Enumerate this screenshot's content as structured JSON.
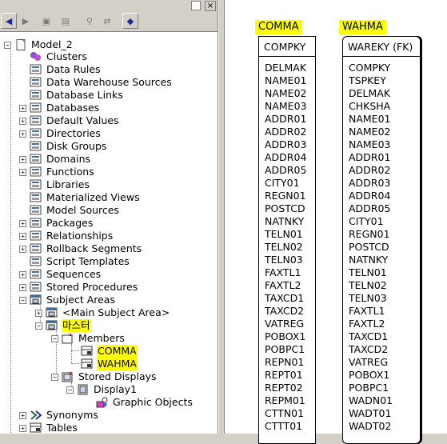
{
  "tree": {
    "root": "Model_2",
    "items": [
      {
        "label": "Clusters",
        "icon": "clusters-icon",
        "expander": ""
      },
      {
        "label": "Data Rules",
        "icon": "data-rules-icon",
        "expander": ""
      },
      {
        "label": "Data Warehouse Sources",
        "icon": "data-warehouse-icon",
        "expander": ""
      },
      {
        "label": "Database Links",
        "icon": "database-links-icon",
        "expander": ""
      },
      {
        "label": "Databases",
        "icon": "databases-icon",
        "expander": "+"
      },
      {
        "label": "Default Values",
        "icon": "default-values-icon",
        "expander": "+"
      },
      {
        "label": "Directories",
        "icon": "directories-icon",
        "expander": "+"
      },
      {
        "label": "Disk Groups",
        "icon": "disk-groups-icon",
        "expander": ""
      },
      {
        "label": "Domains",
        "icon": "domains-icon",
        "expander": "+"
      },
      {
        "label": "Functions",
        "icon": "functions-icon",
        "expander": "+"
      },
      {
        "label": "Libraries",
        "icon": "libraries-icon",
        "expander": ""
      },
      {
        "label": "Materialized Views",
        "icon": "materialized-views-icon",
        "expander": ""
      },
      {
        "label": "Model Sources",
        "icon": "model-sources-icon",
        "expander": ""
      },
      {
        "label": "Packages",
        "icon": "packages-icon",
        "expander": "+"
      },
      {
        "label": "Relationships",
        "icon": "relationships-icon",
        "expander": "+"
      },
      {
        "label": "Rollback Segments",
        "icon": "rollback-segments-icon",
        "expander": "+"
      },
      {
        "label": "Script Templates",
        "icon": "script-templates-icon",
        "expander": ""
      },
      {
        "label": "Sequences",
        "icon": "sequences-icon",
        "expander": "+"
      },
      {
        "label": "Stored Procedures",
        "icon": "stored-procedures-icon",
        "expander": "+"
      },
      {
        "label": "Subject Areas",
        "icon": "subject-areas-icon",
        "expander": "-"
      }
    ],
    "subject_areas": {
      "main": "<Main Subject Area>",
      "master": "마스터",
      "members": "Members",
      "member_items": [
        "COMMA",
        "WAHMA"
      ],
      "stored_displays": "Stored Displays",
      "display1": "Display1",
      "graphic_objects": "Graphic Objects"
    },
    "tail": [
      {
        "label": "Synonyms",
        "icon": "synonyms-icon",
        "expander": "+"
      },
      {
        "label": "Tables",
        "icon": "tables-icon",
        "expander": "+"
      }
    ]
  },
  "toolbar": {
    "close_label": "×"
  },
  "entities": [
    {
      "name": "COMMA",
      "pk": [
        "COMPKY"
      ],
      "columns": [
        "DELMAK",
        "NAME01",
        "NAME02",
        "NAME03",
        "ADDR01",
        "ADDR02",
        "ADDR03",
        "ADDR04",
        "ADDR05",
        "CITY01",
        "REGN01",
        "POSTCD",
        "NATNKY",
        "TELN01",
        "TELN02",
        "TELN03",
        "FAXTL1",
        "FAXTL2",
        "TAXCD1",
        "TAXCD2",
        "VATREG",
        "POBOX1",
        "POBPC1",
        "REPN01",
        "REPT01",
        "REPT02",
        "REPM01",
        "CTTN01",
        "CTTT01"
      ]
    },
    {
      "name": "WAHMA",
      "pk": [
        "WAREKY (FK)"
      ],
      "columns": [
        "COMPKY",
        "TSPKEY",
        "DELMAK",
        "CHKSHA",
        "NAME01",
        "NAME02",
        "NAME03",
        "ADDR01",
        "ADDR02",
        "ADDR03",
        "ADDR04",
        "ADDR05",
        "CITY01",
        "REGN01",
        "POSTCD",
        "NATNKY",
        "TELN01",
        "TELN02",
        "TELN03",
        "FAXTL1",
        "FAXTL2",
        "TAXCD1",
        "TAXCD2",
        "VATREG",
        "POBOX1",
        "POBPC1",
        "WADN01",
        "WADT01",
        "WADT02"
      ]
    }
  ],
  "colors": {
    "highlight": "#ffff00",
    "window_bg": "#d4d0c8"
  }
}
